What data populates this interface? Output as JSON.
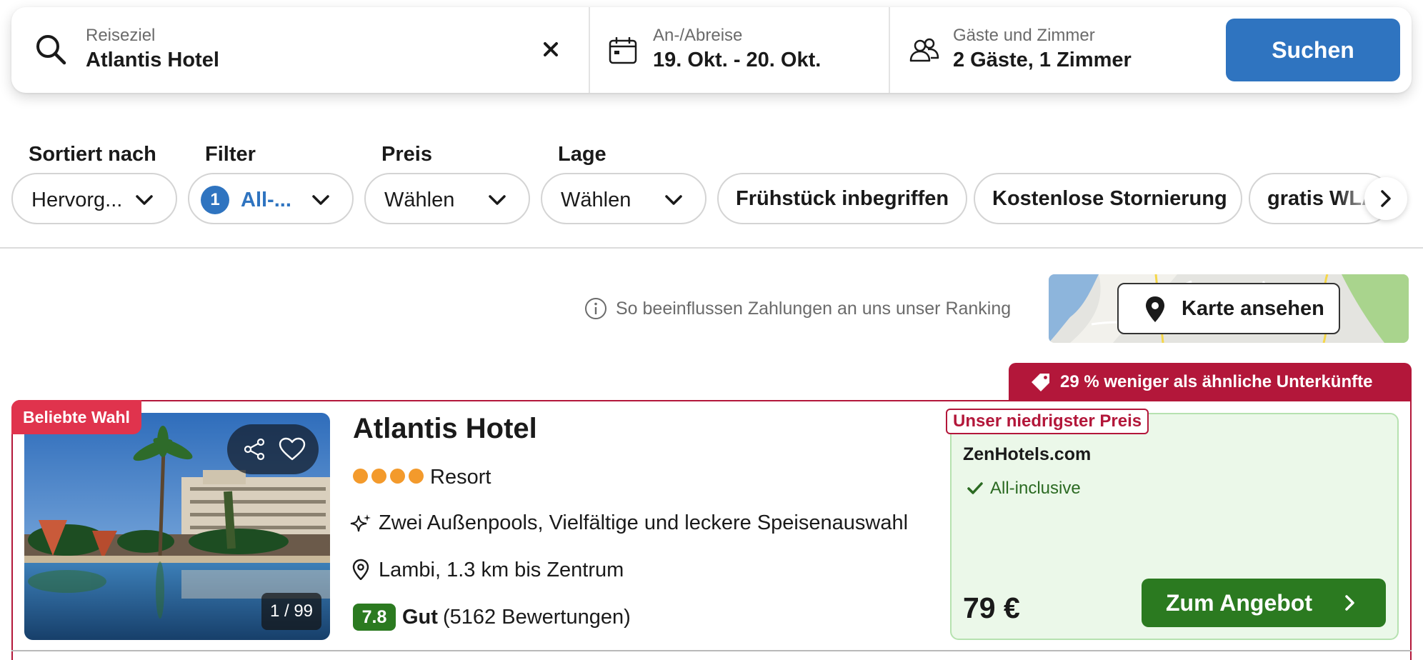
{
  "search": {
    "destination_label": "Reiseziel",
    "destination_value": "Atlantis Hotel",
    "dates_label": "An-/Abreise",
    "dates_value": "19. Okt. - 20. Okt.",
    "guests_label": "Gäste und Zimmer",
    "guests_value": "2 Gäste, 1 Zimmer",
    "search_button": "Suchen"
  },
  "filters": {
    "sort_label": "Sortiert nach",
    "sort_value": "Hervorg...",
    "filter_label": "Filter",
    "filter_count": "1",
    "filter_value": "All-...",
    "price_label": "Preis",
    "price_value": "Wählen",
    "location_label": "Lage",
    "location_value": "Wählen",
    "chips": [
      "Frühstück inbegriffen",
      "Kostenlose Stornierung",
      "gratis WLAN"
    ]
  },
  "info": {
    "ranking_text": "So beeinflussen Zahlungen an uns unser Ranking",
    "map_button": "Karte ansehen"
  },
  "deal": {
    "ribbon_text": "29 % weniger als ähnliche Unterkünfte"
  },
  "hotel": {
    "badge": "Beliebte Wahl",
    "name": "Atlantis Hotel",
    "stars": 4,
    "type": "Resort",
    "amenities": "Zwei Außenpools, Vielfältige und leckere Speisenauswahl",
    "location": "Lambi, 1.3 km bis Zentrum",
    "rating_score": "7.8",
    "rating_word": "Gut",
    "rating_count": "(5162 Bewertungen)",
    "photo_counter": "1 / 99"
  },
  "offer": {
    "badge": "Unser niedrigster Preis",
    "provider": "ZenHotels.com",
    "board": "All-inclusive",
    "price": "79 €",
    "button": "Zum Angebot"
  },
  "colors": {
    "primary_blue": "#2f74c0",
    "deal_red": "#b3173a",
    "popular_pink": "#e0334d",
    "rating_green": "#2b7a20",
    "panel_green": "#ebf8e9",
    "star_orange": "#f39a2c"
  },
  "icons": [
    "search-icon",
    "clear-icon",
    "calendar-icon",
    "guests-icon",
    "chevron-down-icon",
    "chevron-right-icon",
    "info-icon",
    "map-pin-icon",
    "tag-icon",
    "share-icon",
    "heart-icon",
    "sparkle-icon",
    "location-pin-icon",
    "check-icon"
  ]
}
